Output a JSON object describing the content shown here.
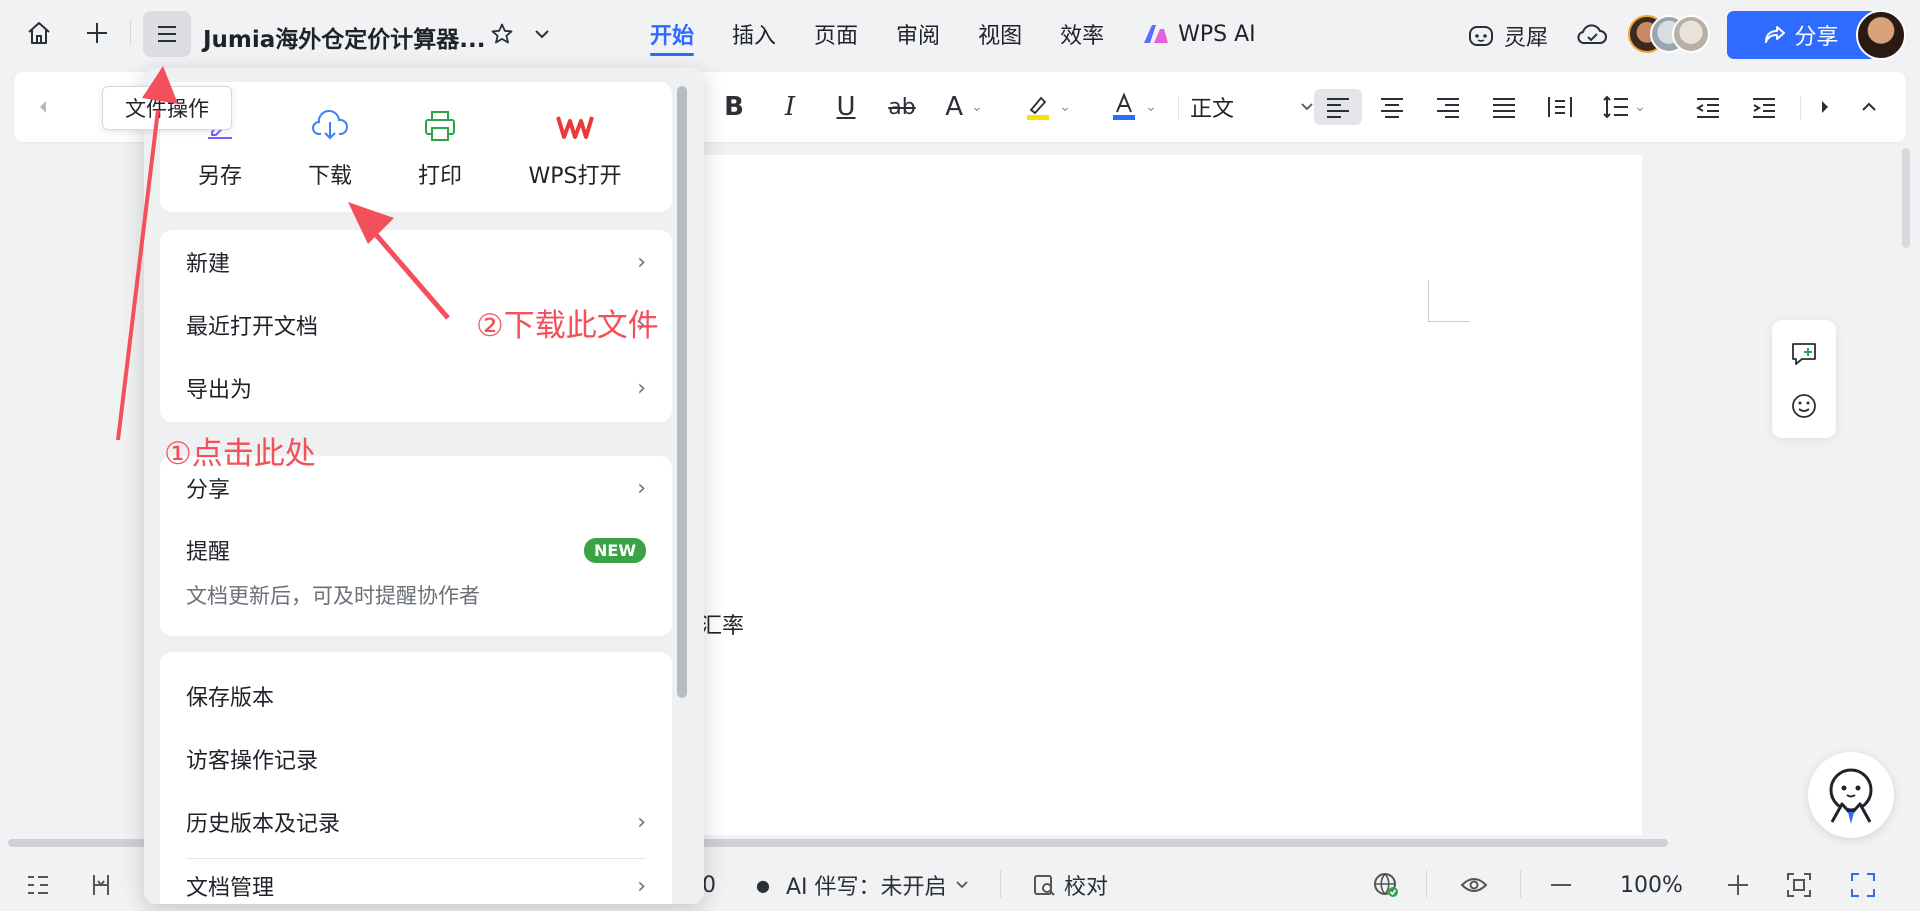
{
  "topbar": {
    "doc_title": "Jumia海外仓定价计算器...",
    "tabs": [
      {
        "label": "开始",
        "active": true
      },
      {
        "label": "插入"
      },
      {
        "label": "页面"
      },
      {
        "label": "审阅"
      },
      {
        "label": "视图"
      },
      {
        "label": "效率"
      },
      {
        "label": "WPS AI"
      }
    ],
    "lingxi_label": "灵犀",
    "share_label": "分享",
    "accent_color": "#2f6bff"
  },
  "ribbon": {
    "paragraph_style": "正文"
  },
  "tooltip": "文件操作",
  "file_menu": {
    "quick_actions": [
      {
        "label": "另存",
        "icon": "save-as-icon"
      },
      {
        "label": "下载",
        "icon": "download-icon"
      },
      {
        "label": "打印",
        "icon": "print-icon"
      },
      {
        "label": "WPS打开",
        "icon": "wps-logo-icon"
      }
    ],
    "group1": [
      "新建",
      "最近打开文档",
      "导出为"
    ],
    "share": "分享",
    "reminder": {
      "label": "提醒",
      "badge": "NEW",
      "desc": "文档更新后，可及时提醒协作者"
    },
    "group3": [
      "保存版本",
      "访客操作记录",
      "历史版本及记录",
      "文档管理"
    ]
  },
  "document": {
    "visible_text": "汇率"
  },
  "annotations": {
    "step1": "①点击此处",
    "step2": "②下载此文件",
    "color": "#f2505a"
  },
  "statusbar": {
    "page_fragment": "0",
    "ai_label": "AI 伴写：未开启",
    "proofread": "校对",
    "zoom": "100%"
  }
}
